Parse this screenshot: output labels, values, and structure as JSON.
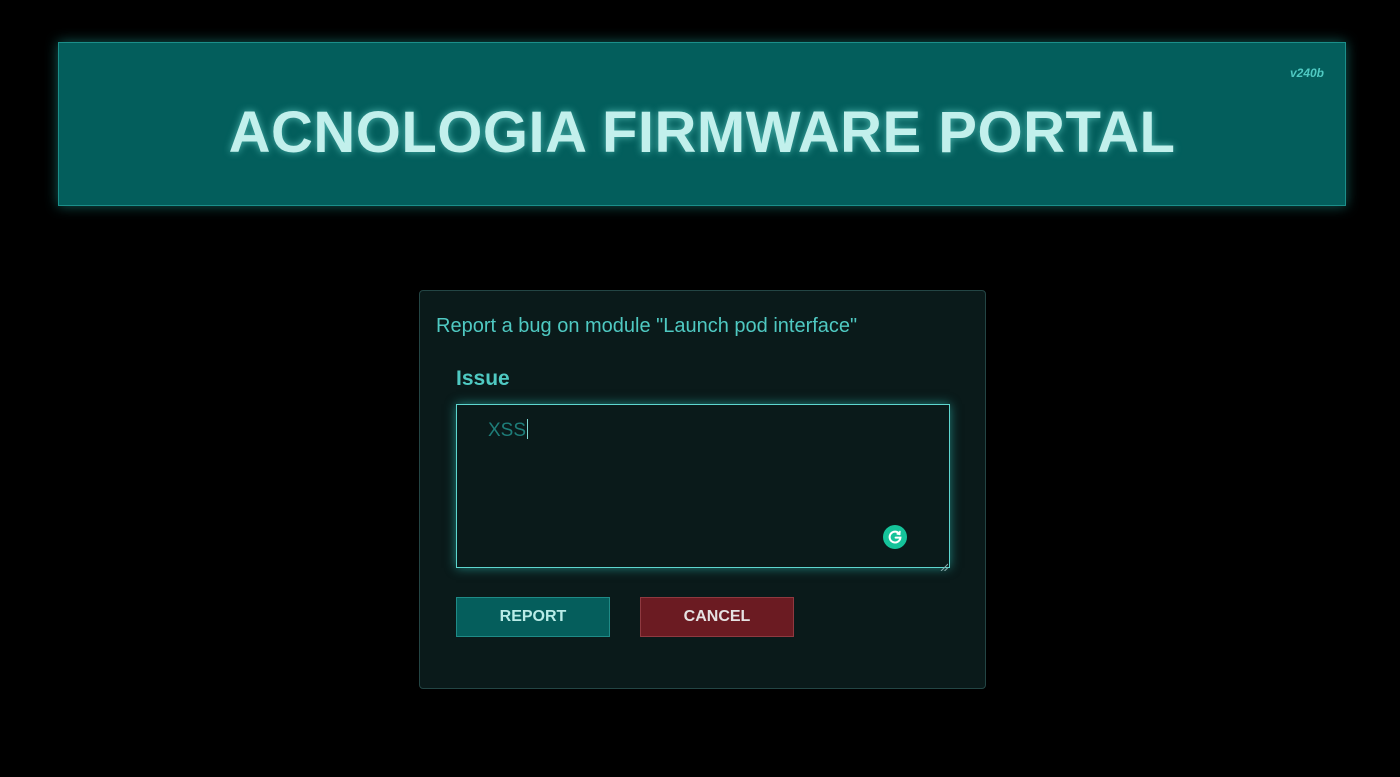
{
  "header": {
    "title": "ACNOLOGIA FIRMWARE PORTAL",
    "version": "v240b"
  },
  "form": {
    "heading": "Report a bug on module \"Launch pod interface\"",
    "issue_label": "Issue",
    "issue_value": "XSS",
    "report_label": "REPORT",
    "cancel_label": "CANCEL"
  },
  "icons": {
    "grammar_assistant": "grammarly-g-icon",
    "resize_handle": "resize-grip-icon"
  },
  "colors": {
    "background": "#000000",
    "banner": "#035e5c",
    "accent": "#4fc9c2",
    "report_button": "#055e5c",
    "cancel_button": "#6b1b22",
    "grammar_icon": "#15c39a"
  }
}
